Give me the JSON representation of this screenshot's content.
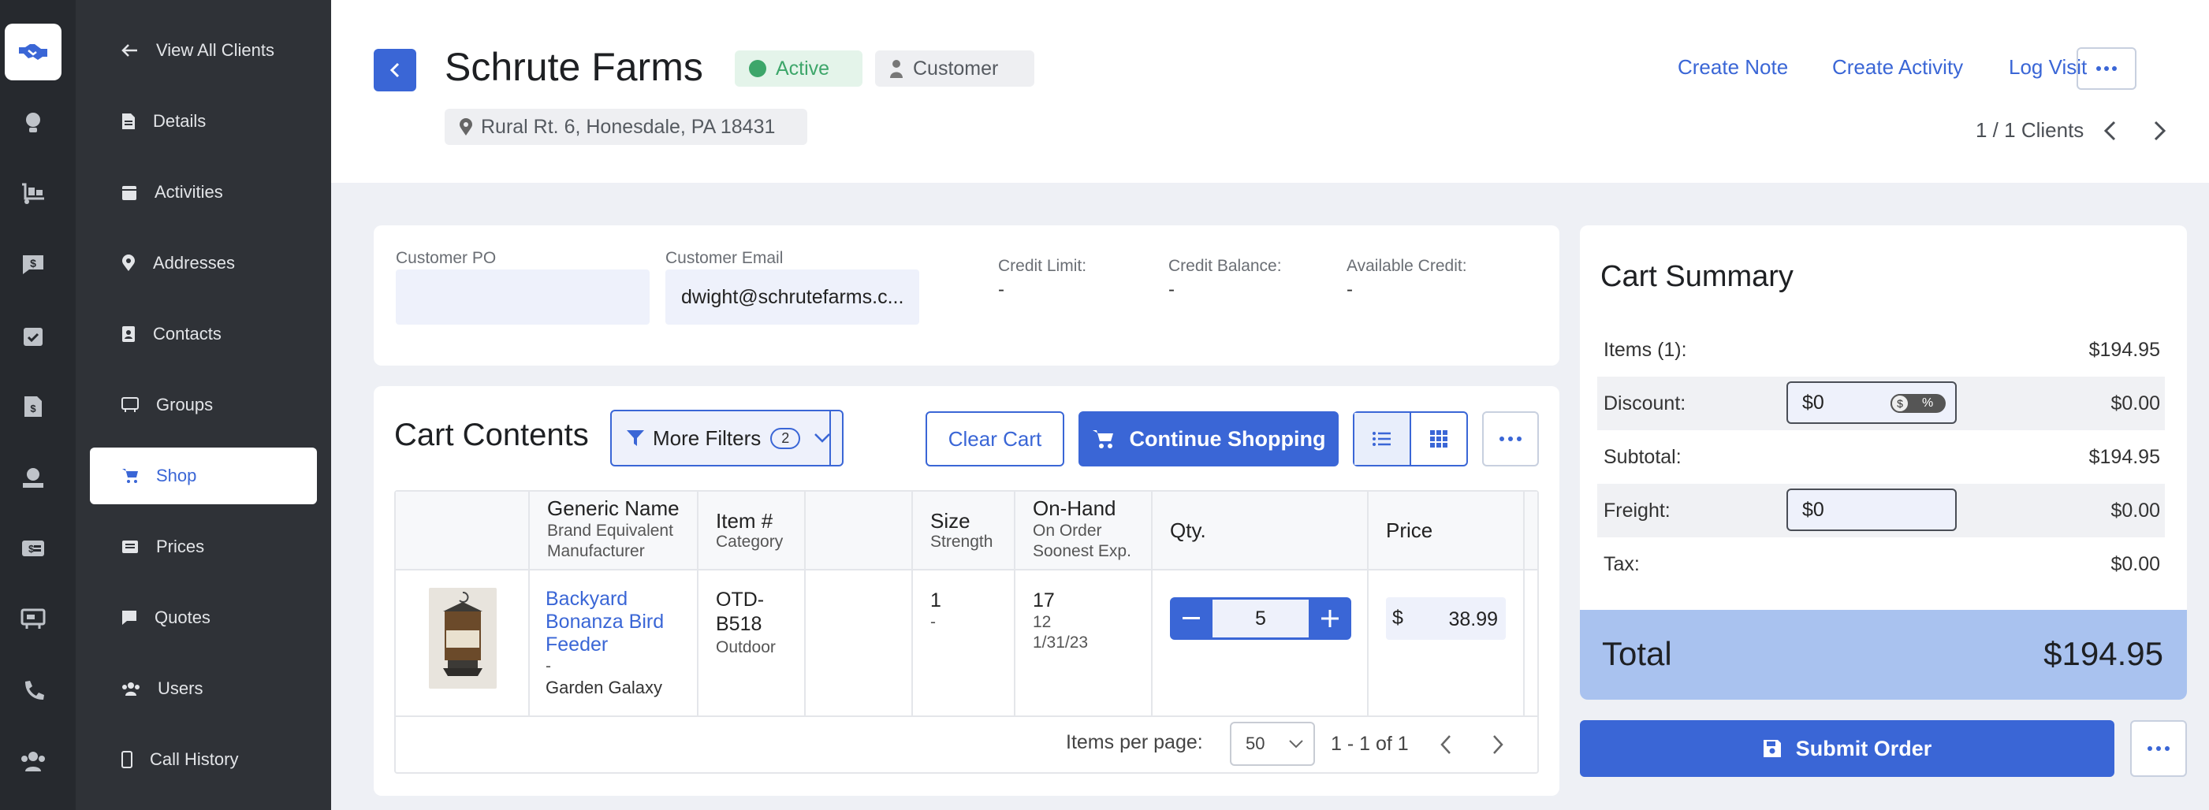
{
  "sidebar": {
    "items": [
      {
        "label": "View All Clients",
        "icon": "arrow-left-icon"
      },
      {
        "label": "Details",
        "icon": "document-icon"
      },
      {
        "label": "Activities",
        "icon": "calendar-icon"
      },
      {
        "label": "Addresses",
        "icon": "map-pin-icon"
      },
      {
        "label": "Contacts",
        "icon": "contact-book-icon"
      },
      {
        "label": "Groups",
        "icon": "group-icon"
      },
      {
        "label": "Shop",
        "icon": "cart-icon",
        "active": true
      },
      {
        "label": "Prices",
        "icon": "price-list-icon"
      },
      {
        "label": "Quotes",
        "icon": "quote-bubble-icon"
      },
      {
        "label": "Users",
        "icon": "users-icon"
      },
      {
        "label": "Call History",
        "icon": "phone-icon"
      }
    ]
  },
  "header": {
    "title": "Schrute Farms",
    "status": "Active",
    "type": "Customer",
    "address": "Rural Rt. 6, Honesdale, PA 18431",
    "links": [
      "Create Note",
      "Create Activity",
      "Log Visit"
    ],
    "pager": "1 / 1 Clients"
  },
  "fields": {
    "po_label": "Customer PO",
    "po_value": "",
    "email_label": "Customer Email",
    "email_value": "dwight@schrutefarms.c...",
    "credit_limit_label": "Credit Limit:",
    "credit_limit": "-",
    "credit_balance_label": "Credit Balance:",
    "credit_balance": "-",
    "available_credit_label": "Available Credit:",
    "available_credit": "-"
  },
  "cart": {
    "title": "Cart Contents",
    "filters_label": "More Filters",
    "filters_count": "2",
    "clear_label": "Clear Cart",
    "continue_label": "Continue Shopping",
    "columns": {
      "name": "Generic Name",
      "name_sub1": "Brand Equivalent",
      "name_sub2": "Manufacturer",
      "item": "Item #",
      "item_sub": "Category",
      "size": "Size",
      "size_sub": "Strength",
      "onhand": "On-Hand",
      "onhand_sub1": "On Order",
      "onhand_sub2": "Soonest Exp.",
      "qty": "Qty.",
      "price": "Price"
    },
    "row": {
      "name_l1": "Backyard",
      "name_l2": "Bonanza Bird",
      "name_l3": "Feeder",
      "brand": "-",
      "manufacturer": "Garden Galaxy",
      "item_l1": "OTD-",
      "item_l2": "B518",
      "category": "Outdoor",
      "size": "1",
      "strength": "-",
      "onhand": "17",
      "onorder": "12",
      "exp": "1/31/23",
      "qty": "5",
      "currency": "$",
      "price": "38.99"
    },
    "footer": {
      "per_page_label": "Items per page:",
      "per_page": "50",
      "range": "1 - 1 of 1"
    }
  },
  "summary": {
    "title": "Cart Summary",
    "items_label": "Items (1):",
    "items": "$194.95",
    "discount_label": "Discount:",
    "discount_input": "$0",
    "discount": "$0.00",
    "subtotal_label": "Subtotal:",
    "subtotal": "$194.95",
    "freight_label": "Freight:",
    "freight_input": "$0",
    "freight": "$0.00",
    "tax_label": "Tax:",
    "tax": "$0.00",
    "total_label": "Total",
    "total": "$194.95",
    "submit_label": "Submit Order"
  },
  "colors": {
    "accent": "#3a66d6",
    "sidebar": "#2f3237",
    "rail": "#26292e",
    "active_green": "#3da66a",
    "total_bg": "#a9c2ef"
  }
}
